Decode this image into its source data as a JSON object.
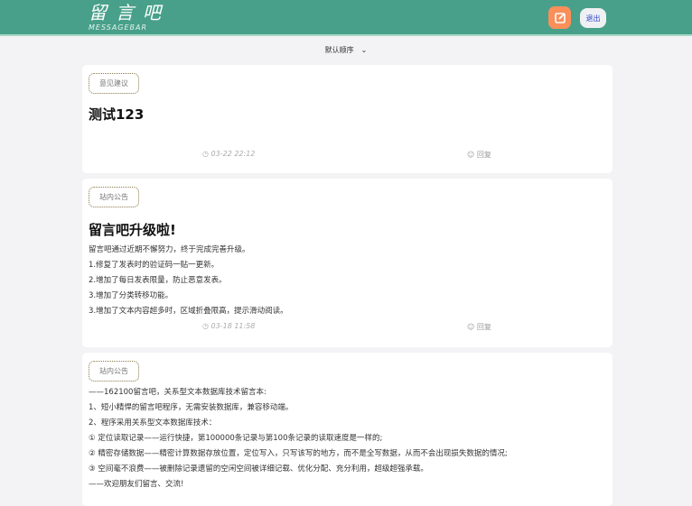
{
  "header": {
    "logo_cn": "留言吧",
    "logo_en": "MESSAGEBAR",
    "logout": "退出"
  },
  "sort": {
    "selected": "默认顺序"
  },
  "posts": [
    {
      "tag": "意见建议",
      "title": "测试123",
      "time": "03-22 22:12",
      "reply": "回复"
    },
    {
      "tag": "站内公告",
      "title": "留言吧升级啦!",
      "lines": [
        "留言吧通过近期不懈努力，终于完成完善升级。",
        "1.修复了发表时的验证码一贴一更新。",
        "2.增加了每日发表限量，防止恶意发表。",
        "3.增加了分类转移功能。",
        "3.增加了文本内容超多时，区域折叠限高，提示滑动阅读。"
      ],
      "time": "03-18 11:58",
      "reply": "回复"
    },
    {
      "tag": "站内公告",
      "lines": [
        "——162100留言吧，关系型文本数据库技术留言本:",
        "1、短小精悍的留言吧程序，无需安装数据库，兼容移动端。",
        "2、程序采用关系型文本数据库技术：",
        "① 定位读取记录——运行快捷，第100000条记录与第100条记录的读取速度是一样的;",
        "② 精密存储数据——精密计算数据存放位置，定位写入，只写该写的地方，而不是全写数据，从而不会出现损失数据的情况;",
        "③ 空间毫不浪费——被删除记录遗留的空闲空间被详细记载、优化分配、充分利用，超级超强承载。",
        "——欢迎朋友们留言、交流!"
      ]
    }
  ]
}
